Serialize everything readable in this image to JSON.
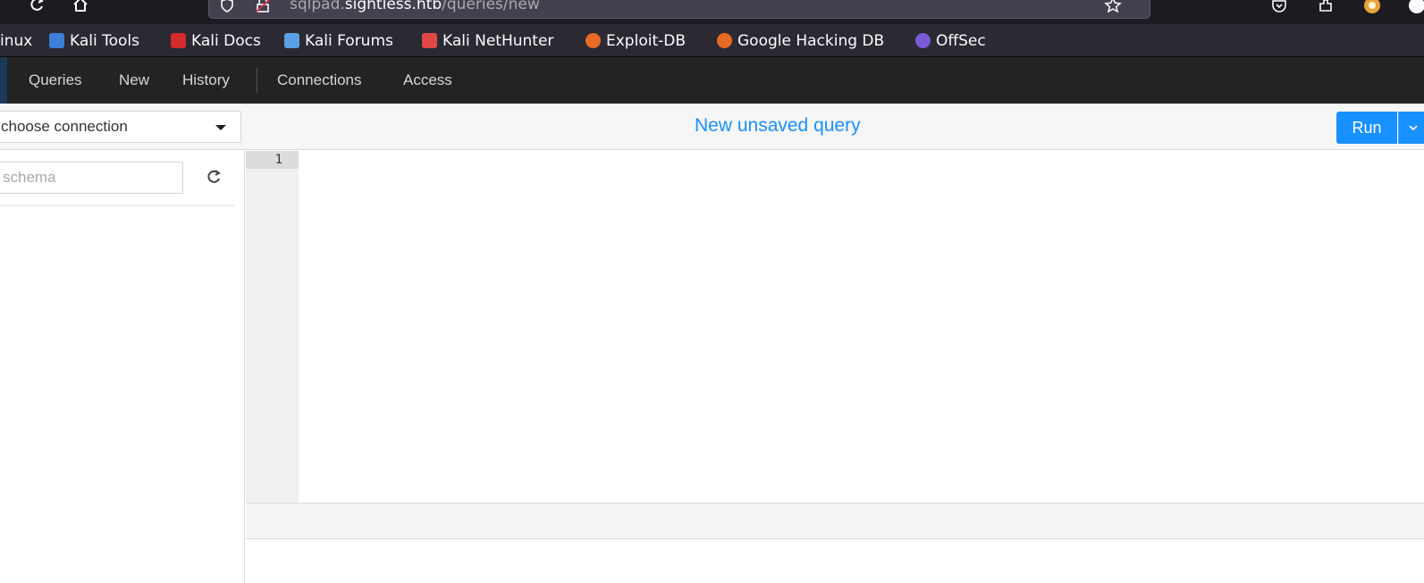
{
  "browser": {
    "url_prefix": "sqlpad.",
    "url_host": "sightless.htb",
    "url_path": "/queries/new",
    "bookmarks": [
      {
        "label": "inux",
        "color": ""
      },
      {
        "label": "Kali Tools",
        "color": "#3b7fd9"
      },
      {
        "label": "Kali Docs",
        "color": "#d62b2b"
      },
      {
        "label": "Kali Forums",
        "color": "#5aa0e6"
      },
      {
        "label": "Kali NetHunter",
        "color": "#e04848"
      },
      {
        "label": "Exploit-DB",
        "color": "#e86a24"
      },
      {
        "label": "Google Hacking DB",
        "color": "#e86a24"
      },
      {
        "label": "OffSec",
        "color": "#7a5bd6"
      }
    ]
  },
  "nav": {
    "items": [
      "Queries",
      "New",
      "History",
      "Connections",
      "Access"
    ]
  },
  "toolbar": {
    "connection_label": "choose connection",
    "query_title": "New unsaved query",
    "run_label": "Run"
  },
  "sidebar": {
    "schema_placeholder": "schema"
  },
  "editor": {
    "line_number": "1"
  },
  "colors": {
    "accent": "#1890ff",
    "navbar": "#232323"
  }
}
